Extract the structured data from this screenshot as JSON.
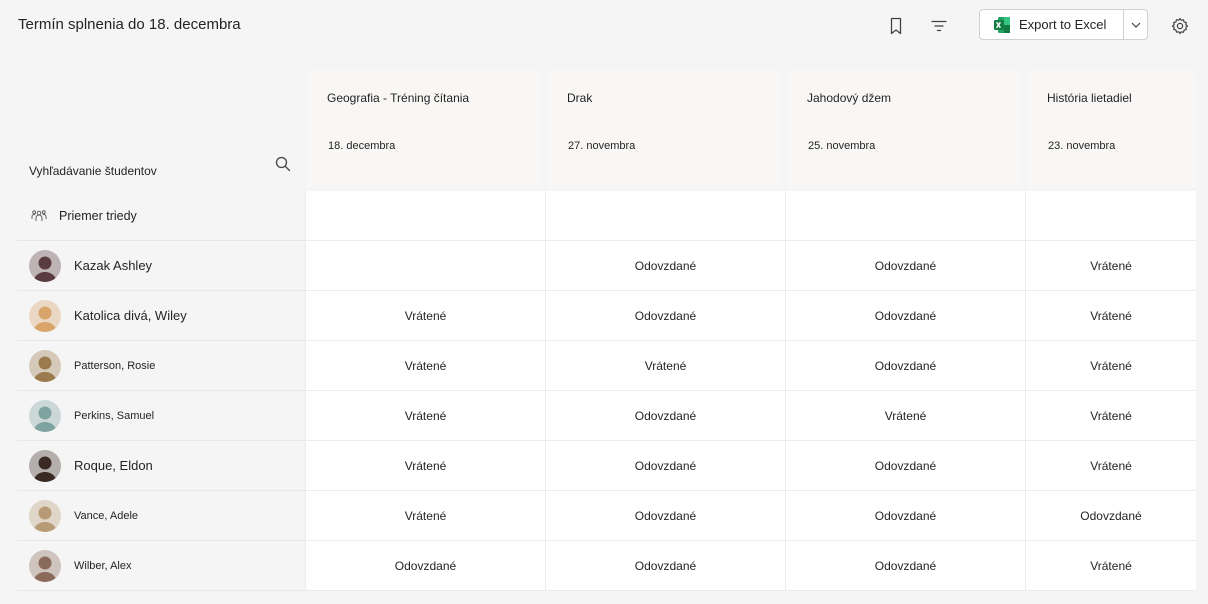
{
  "header": {
    "title": "Termín splnenia do 18. decembra",
    "export_label": "Export to Excel"
  },
  "search": {
    "label": "Vyhľadávanie študentov"
  },
  "assignments": [
    {
      "title": "Geografia - Tréning čítania",
      "due": "18. decembra"
    },
    {
      "title": "Drak",
      "due": "27. novembra"
    },
    {
      "title": "Jahodový džem",
      "due": "25. novembra"
    },
    {
      "title": "História lietadiel",
      "due": "23. novembra"
    }
  ],
  "class_average": {
    "label": "Priemer triedy"
  },
  "students": [
    {
      "name": "Kazak Ashley",
      "status": [
        "",
        "Odovzdané",
        "Odovzdané",
        "Vrátené"
      ],
      "avatar_color": "#5a3b3f"
    },
    {
      "name": "Katolica divá, Wiley",
      "status": [
        "Vrátené",
        "Odovzdané",
        "Odovzdané",
        "Vrátené"
      ],
      "avatar_color": "#d9a46a"
    },
    {
      "name": "Patterson, Rosie",
      "status": [
        "Vrátené",
        "Vrátené",
        "Odovzdané",
        "Vrátené"
      ],
      "avatar_color": "#9b7a4e"
    },
    {
      "name": "Perkins, Samuel",
      "status": [
        "Vrátené",
        "Odovzdané",
        "Vrátené",
        "Vrátené"
      ],
      "avatar_color": "#7fa3a0"
    },
    {
      "name": "Roque, Eldon",
      "status": [
        "Vrátené",
        "Odovzdané",
        "Odovzdané",
        "Vrátené"
      ],
      "avatar_color": "#3b2a24"
    },
    {
      "name": "Vance, Adele",
      "status": [
        "Vrátené",
        "Odovzdané",
        "Odovzdané",
        "Odovzdané"
      ],
      "avatar_color": "#b79a76"
    },
    {
      "name": "Wilber, Alex",
      "status": [
        "Odovzdané",
        "Odovzdané",
        "Odovzdané",
        "Vrátené"
      ],
      "avatar_color": "#8a6a5a"
    }
  ],
  "icons": {
    "bookmark": "bookmark-icon",
    "filter": "filter-icon",
    "excel": "excel-icon",
    "settings": "gear-icon",
    "search": "search-icon",
    "class": "people-icon"
  }
}
